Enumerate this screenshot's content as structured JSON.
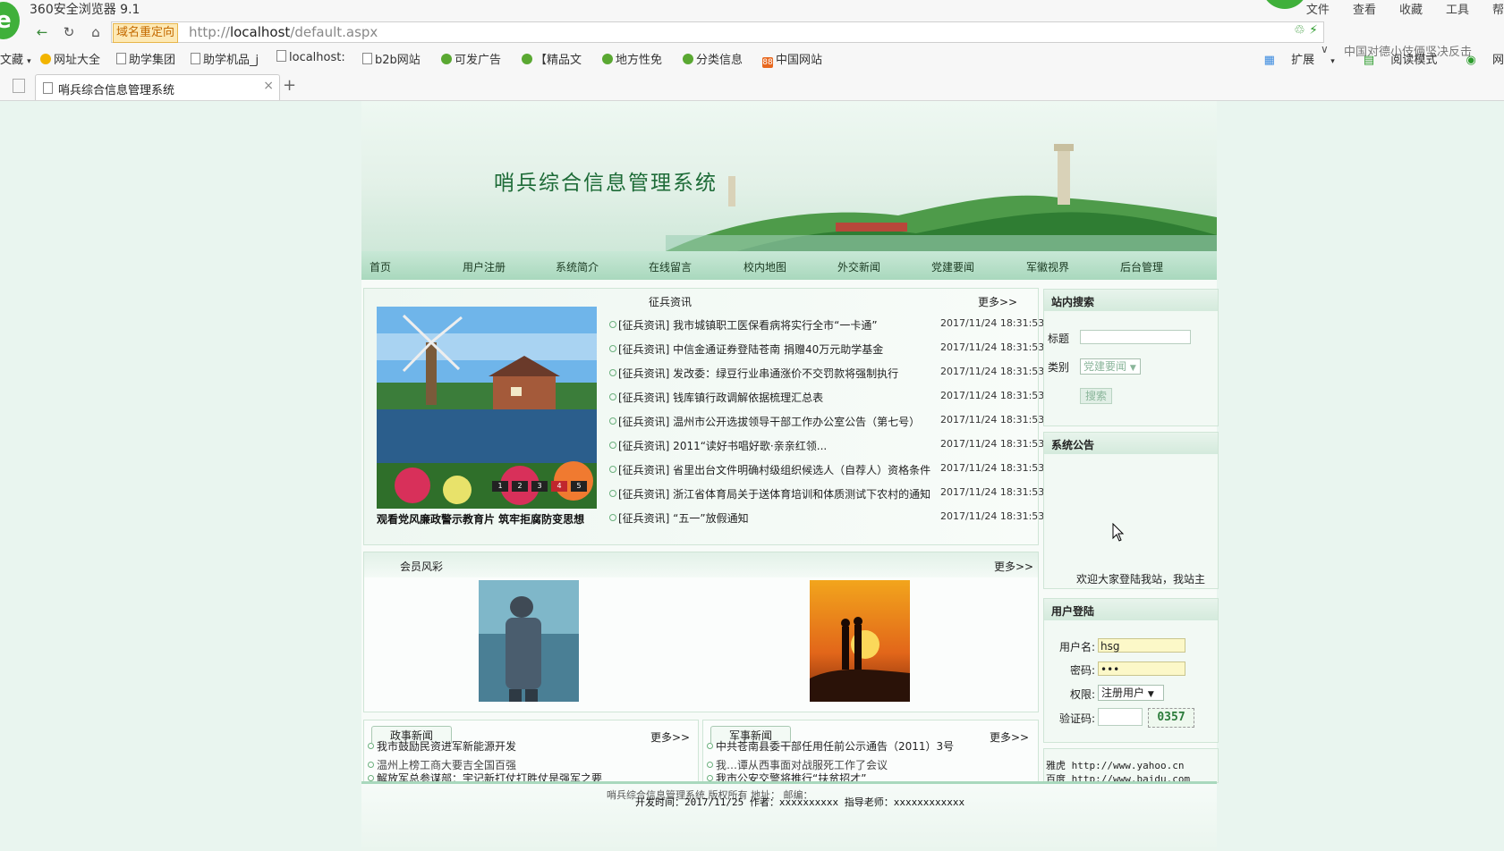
{
  "browser": {
    "app_title": "360安全浏览器 9.1",
    "logo_glyph": "e",
    "top_menus": [
      "文件",
      "查看",
      "收藏",
      "工具",
      "帮"
    ],
    "redirect_badge": "域名重定向",
    "url_prefix": "http://",
    "url_host": "localhost",
    "url_path": "/default.aspx",
    "news_ticker": "中国对德小伎俩坚决反击",
    "bookmarks": [
      "文藏",
      "网址大全",
      "助学集团",
      "助学机品_j",
      "localhost:",
      "b2b网站",
      "可发广告",
      "【精品文",
      "地方性免",
      "分类信息",
      "中国网站"
    ],
    "extensions_label": "扩展",
    "read_mode_label": "阅读模式",
    "ext_tail": "网",
    "tab_title": "哨兵综合信息管理系统",
    "tab_new": "+",
    "tab_close": "×",
    "badge_88": "88"
  },
  "site": {
    "title": "哨兵综合信息管理系统",
    "nav": [
      "首页",
      "用户注册",
      "系统简介",
      "在线留言",
      "校内地图",
      "外交新闻",
      "党建要闻",
      "军徽视界",
      "后台管理"
    ]
  },
  "news": {
    "header": "征兵资讯",
    "more": "更多>>",
    "slide_caption": "观看党风廉政警示教育片 筑牢拒腐防变思想",
    "slide_dots": [
      "1",
      "2",
      "3",
      "4",
      "5"
    ],
    "items": [
      {
        "title": "[征兵资讯] 我市城镇职工医保看病将实行全市“一卡通”",
        "date": "2017/11/24 18:31:53"
      },
      {
        "title": "[征兵资讯] 中信金通证券登陆苍南 捐赠40万元助学基金",
        "date": "2017/11/24 18:31:53"
      },
      {
        "title": "[征兵资讯] 发改委：绿豆行业串通涨价不交罚款将强制执行",
        "date": "2017/11/24 18:31:53"
      },
      {
        "title": "[征兵资讯] 钱库镇行政调解依据梳理汇总表",
        "date": "2017/11/24 18:31:53"
      },
      {
        "title": "[征兵资讯] 温州市公开选拔领导干部工作办公室公告（第七号）",
        "date": "2017/11/24 18:31:53"
      },
      {
        "title": "[征兵资讯] 2011“读好书唱好歌·亲亲红领...",
        "date": "2017/11/24 18:31:53"
      },
      {
        "title": "[征兵资讯] 省里出台文件明确村级组织候选人（自荐人）资格条件",
        "date": "2017/11/24 18:31:53"
      },
      {
        "title": "[征兵资讯] 浙江省体育局关于送体育培训和体质测试下农村的通知",
        "date": "2017/11/24 18:31:53"
      },
      {
        "title": "[征兵资讯] “五一”放假通知",
        "date": "2017/11/24 18:31:53"
      }
    ]
  },
  "members": {
    "title": "会员风彩",
    "more": "更多>>"
  },
  "politics": {
    "tab": "政事新闻",
    "more": "更多>>",
    "items": [
      "我市鼓励民资进军新能源开发",
      "温州上榜工商大要吉全国百强",
      "解放军总参谋部：宇记新打仗打胜仗是强军之要"
    ]
  },
  "military": {
    "tab": "军事新闻",
    "more": "更多>>",
    "items": [
      "中共苍南县委干部任用任前公示通告（2011）3号",
      "我…谭从西事面对战服死工作了会议",
      "我市公安交警将推行“扶贫招才”"
    ]
  },
  "search": {
    "title": "站内搜索",
    "label_title": "标题",
    "label_category": "类别",
    "category_value": "党建要闻",
    "button": "搜索"
  },
  "notice": {
    "title": "系统公告",
    "text": "欢迎大家登陆我站，我站主"
  },
  "login": {
    "title": "用户登陆",
    "username_label": "用户名:",
    "username_value": "hsg",
    "password_label": "密码:",
    "password_value": "•••",
    "role_label": "权限:",
    "role_value": "注册用户",
    "captcha_label": "验证码:",
    "captcha_value": "0357"
  },
  "links": {
    "row1": "雅虎  http://www.yahoo.cn",
    "row2": "百度  http://www.baidu.com"
  },
  "footer": {
    "line1": "哨兵综合信息管理系统 版权所有 地址：               邮编：",
    "line2": "开发时间：2017/11/25 作者：xxxxxxxxxx 指导老师：xxxxxxxxxxxx"
  },
  "colors": {
    "accent": "#1d6b37",
    "nav_bg": "#a9d8bd",
    "page_bg": "#e9f5ef",
    "browser_green": "#3fb03a"
  }
}
